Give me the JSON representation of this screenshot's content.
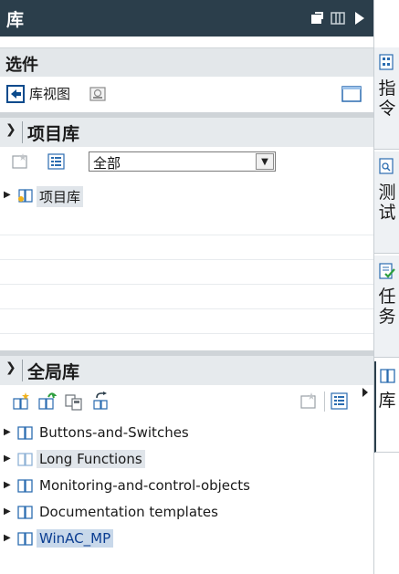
{
  "titlebar": {
    "title": "库"
  },
  "options": {
    "label": "选件",
    "view_label": "库视图"
  },
  "project_library": {
    "header": "项目库",
    "filter_value": "全部",
    "items": [
      {
        "label": "项目库"
      }
    ]
  },
  "global_library": {
    "header": "全局库",
    "items": [
      {
        "label": "Buttons-and-Switches"
      },
      {
        "label": "Long Functions"
      },
      {
        "label": "Monitoring-and-control-objects"
      },
      {
        "label": "Documentation templates"
      },
      {
        "label": "WinAC_MP"
      }
    ]
  },
  "dock_tabs": [
    {
      "label": "指令"
    },
    {
      "label": "测试"
    },
    {
      "label": "任务"
    },
    {
      "label": "库"
    }
  ],
  "colors": {
    "titlebar": "#2b3e4b",
    "section": "#e6eaed",
    "selected": "#c8d8ea"
  }
}
